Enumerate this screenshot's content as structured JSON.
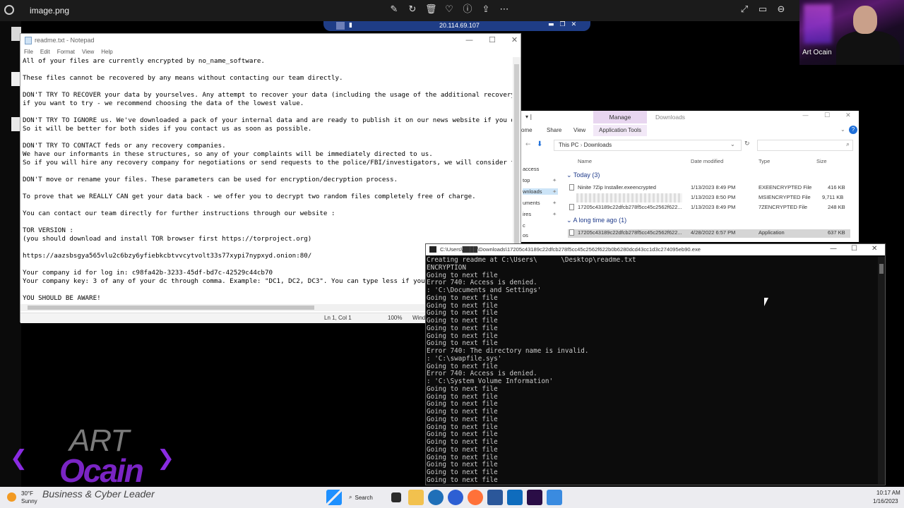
{
  "viewer": {
    "filename": "image.png"
  },
  "rdp": {
    "ip": "20.114.69.107"
  },
  "webcam": {
    "name": "Art Ocain"
  },
  "notepad": {
    "title": "readme.txt - Notepad",
    "menu": [
      "File",
      "Edit",
      "Format",
      "View",
      "Help"
    ],
    "lines": [
      "All of your files are currently encrypted by no_name_software.",
      "",
      "These files cannot be recovered by any means without contacting our team directly.",
      "",
      "DON'T TRY TO RECOVER your data by yourselves. Any attempt to recover your data (including the usage of the additional recovery sof",
      "if you want to try - we recommend choosing the data of the lowest value.",
      "",
      "DON'T TRY TO IGNORE us. We've downloaded a pack of your internal data and are ready to publish it on our news website if you do no",
      "So it will be better for both sides if you contact us as soon as possible.",
      "",
      "DON'T TRY TO CONTACT feds or any recovery companies.",
      "We have our informants in these structures, so any of your complaints will be immediately directed to us.",
      "So if you will hire any recovery company for negotiations or send requests to the police/FBI/investigators, we will consider this",
      "",
      "DON'T move or rename your files. These parameters can be used for encryption/decryption process.",
      "",
      "To prove that we REALLY CAN get your data back - we offer you to decrypt two random files completely free of charge.",
      "",
      "You can contact our team directly for further instructions through our website :",
      "",
      "TOR VERSION :",
      "(you should download and install TOR browser first https://torproject.org)",
      "",
      "https://aazsbsgya565vlu2c6bzy6yfiebkcbtvvcytvolt33s77xypi7nypxyd.onion:80/",
      "",
      "Your company id for log in: c98fa42b-3233-45df-bd7c-42529c44cb70",
      "Your company key: 3 of any of your dc through comma. Example: \"DC1, DC2, DC3\". You can type less if you hav",
      "",
      "YOU SHOULD BE AWARE!"
    ],
    "status": {
      "position": "Ln 1, Col 1",
      "zoom": "100%",
      "eol": "Wind"
    }
  },
  "explorer": {
    "title": "Downloads",
    "context_tab": "Manage",
    "context_sub": "Application Tools",
    "ribbon": [
      "ome",
      "Share",
      "View"
    ],
    "path": [
      "This PC",
      "Downloads"
    ],
    "nav": [
      "access",
      "top",
      "wnloads",
      "uments",
      "ires",
      "c",
      "os"
    ],
    "columns": [
      "Name",
      "Date modified",
      "Type",
      "Size"
    ],
    "groups": [
      {
        "label": "Today (3)",
        "rows": [
          {
            "name": "Ninite 7Zip Installer.exeencrypted",
            "date": "1/13/2023 8:49 PM",
            "type": "EXEENCRYPTED File",
            "size": "416 KB"
          },
          {
            "name": "",
            "date": "1/13/2023 8:50 PM",
            "type": "MSIENCRYPTED File",
            "size": "9,711 KB"
          },
          {
            "name": "17205c43189c22dfcb278f5cc45c2562f622...",
            "date": "1/13/2023 8:49 PM",
            "type": "7ZENCRYPTED File",
            "size": "248 KB"
          }
        ]
      },
      {
        "label": "A long time ago (1)",
        "rows": [
          {
            "name": "17205c43189c22dfcb278f5cc45c2562f622...",
            "date": "4/28/2022 6:57 PM",
            "type": "Application",
            "size": "637 KB"
          }
        ]
      }
    ]
  },
  "cmd": {
    "title": "C:\\Users\\████\\Downloads\\17205c43189c22dfcb278f5cc45c2562f622b0b6280dcd43cc1d3c274095eb90.exe",
    "lines": [
      "Creating readme at C:\\Users\\      \\Desktop\\readme.txt",
      "ENCRYPTION",
      "Going to next file",
      "Error 740: Access is denied.",
      ": 'C:\\Documents and Settings'",
      "Going to next file",
      "Going to next file",
      "Going to next file",
      "Going to next file",
      "Going to next file",
      "Going to next file",
      "Going to next file",
      "Error 740: The directory name is invalid.",
      ": 'C:\\swapfile.sys'",
      "Going to next file",
      "Error 740: Access is denied.",
      ": 'C:\\System Volume Information'",
      "Going to next file",
      "Going to next file",
      "Going to next file",
      "Going to next file",
      "Going to next file",
      "Going to next file",
      "Going to next file",
      "Going to next file",
      "Going to next file",
      "Going to next file",
      "Going to next file",
      "Going to next file",
      "Going to next file"
    ]
  },
  "brand": {
    "art": "ART",
    "ocain": "Ocain"
  },
  "taskbar": {
    "temp": "30°F",
    "condition": "Sunny",
    "tagline": "Business & Cyber Leader",
    "search": "Search",
    "time": "10:17 AM",
    "date": "1/16/2023"
  }
}
